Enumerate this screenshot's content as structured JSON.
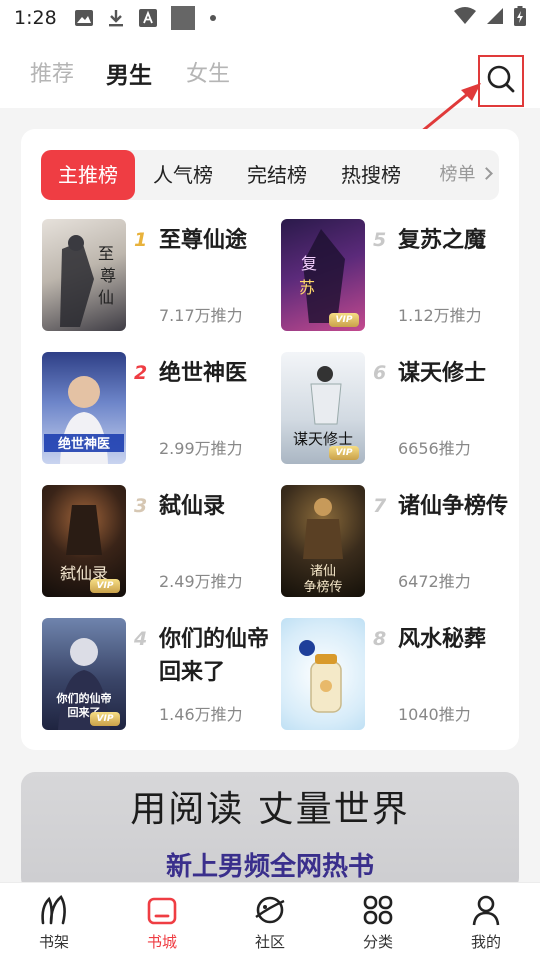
{
  "status_bar": {
    "time": "1:28"
  },
  "top_tabs": [
    "推荐",
    "男生",
    "女生"
  ],
  "rank_tabs": [
    "主推榜",
    "人气榜",
    "完结榜",
    "热搜榜",
    "榜单"
  ],
  "books": [
    {
      "rank": "1",
      "title": "至尊仙途",
      "votes": "7.17万推力",
      "colors": [
        "#d9d3cc",
        "#4c4b52"
      ]
    },
    {
      "rank": "2",
      "title": "绝世神医",
      "votes": "2.99万推力",
      "colors": [
        "#2d4fa8",
        "#b9c7ea"
      ]
    },
    {
      "rank": "3",
      "title": "弑仙录",
      "votes": "2.49万推力",
      "colors": [
        "#1a1410",
        "#7a4a2a"
      ]
    },
    {
      "rank": "4",
      "title": "你们的仙帝回来了",
      "votes": "1.46万推力",
      "colors": [
        "#2b3150",
        "#8fa3c7"
      ]
    },
    {
      "rank": "5",
      "title": "复苏之魔",
      "votes": "1.12万推力",
      "colors": [
        "#3a1a55",
        "#c24a9e"
      ]
    },
    {
      "rank": "6",
      "title": "谋天修士",
      "votes": "6656推力",
      "colors": [
        "#e9eef2",
        "#9aa8b6"
      ]
    },
    {
      "rank": "7",
      "title": "诸仙争榜传",
      "votes": "6472推力",
      "colors": [
        "#1f1a14",
        "#8a6a3a"
      ]
    },
    {
      "rank": "8",
      "title": "风水秘葬",
      "votes": "1040推力",
      "colors": [
        "#cfe6f6",
        "#f4e9c8"
      ]
    }
  ],
  "banner": {
    "slogan": "用阅读 丈量世界",
    "sub": "新上男频全网热书"
  },
  "bottom_nav": [
    "书架",
    "书城",
    "社区",
    "分类",
    "我的"
  ],
  "accent_color": "#ef3d43"
}
